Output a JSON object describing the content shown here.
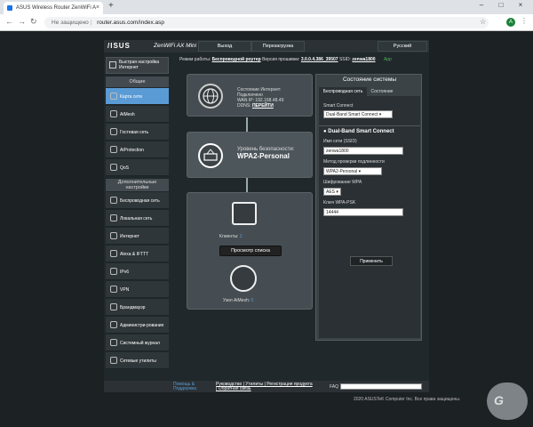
{
  "browser": {
    "tab_title": "ASUS Wireless Router ZenWiFi A",
    "url_security": "Не защищено",
    "url": "router.asus.com/index.asp",
    "avatar_letter": "A"
  },
  "router": {
    "logo": "/ISUS",
    "product": "ZenWiFi AX Mini",
    "logout": "Выход",
    "reboot": "Перезагрузка",
    "language": "Русский",
    "status_mode_label": "Режим работы:",
    "status_mode": "Беспроводной роутер",
    "status_fw_label": "Версия прошивки:",
    "status_fw": "3.0.0.4.386_39507",
    "status_ssid_label": "SSID:",
    "status_ssid": "zenwa1800",
    "status_app": "App"
  },
  "sidebar": {
    "quick_setup": "Быстрая настройка Интернет",
    "general_head": "Общие",
    "general_items": [
      {
        "label": "Карта сети",
        "active": true
      },
      {
        "label": "AiMesh",
        "active": false
      },
      {
        "label": "Гостевая сеть",
        "active": false
      },
      {
        "label": "AiProtection",
        "active": false
      },
      {
        "label": "QoS",
        "active": false
      }
    ],
    "advanced_head": "Дополнительные настройки",
    "advanced_items": [
      {
        "label": "Беспроводная сеть"
      },
      {
        "label": "Локальная сеть"
      },
      {
        "label": "Интернет"
      },
      {
        "label": "Alexa & IFTTT"
      },
      {
        "label": "IPv6"
      },
      {
        "label": "VPN"
      },
      {
        "label": "Брандмауэр"
      },
      {
        "label": "Администри-рование"
      },
      {
        "label": "Системный журнал"
      },
      {
        "label": "Сетевые утилиты"
      }
    ]
  },
  "netmap": {
    "internet_status_label": "Состояние Интернет:",
    "internet_status": "Подключено",
    "wan_ip": "WAN IP: 192.168.48.49",
    "ddns_label": "DDNS:",
    "ddns_link": "ПЕРЕЙТИ",
    "security_label": "Уровень безопасности:",
    "security_value": "WPA2-Personal",
    "clients_label": "Клиенты:",
    "clients_count": "2",
    "view_list": "Просмотр списка",
    "aimesh_label": "Узел AiMesh:",
    "aimesh_count": "0"
  },
  "panel": {
    "title": "Состояние системы",
    "tab_wireless": "Беспроводная сеть",
    "tab_status": "Состояние",
    "smart_connect_label": "Smart Connect",
    "smart_connect_value": "Dual-Band Smart Connect",
    "section_title": "Dual-Band Smart Connect",
    "ssid_label": "Имя сети (SSID)",
    "ssid_value": "zenwa1800",
    "auth_label": "Метод проверки подлинности",
    "auth_value": "WPA2-Personal",
    "wpa_enc_label": "Шифрование WPA",
    "wpa_enc_value": "AES",
    "wpa_key_label": "Ключ WPA-PSK",
    "wpa_key_value": "14444",
    "apply": "Применить"
  },
  "footer": {
    "help": "Помощь & Поддержка",
    "links": "Руководство | Утилиты | Регистрация продукта | Обратная связь",
    "faq": "FAQ",
    "copyright": "2020 ASUSTeK Computer Inc. Все права защищены."
  },
  "watermark": "GECID"
}
